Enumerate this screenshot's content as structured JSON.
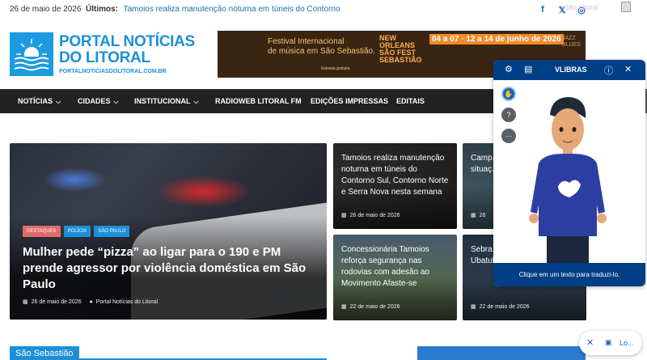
{
  "topbar": {
    "date": "26 de maio de 2026",
    "latest_label": "Últimos:",
    "latest_headline": "Tamoios realiza manutenção noturna em túneis do Contorno",
    "faded_text": "dão Litoral"
  },
  "header": {
    "logo_line1": "PORTAL NOTÍCIAS",
    "logo_line2": "DO LITORAL",
    "logo_url": "PORTALNOTICIASDOLITORAL.COM.BR",
    "banner": {
      "line1": "Festival Internacional",
      "line2": "de música em São Sebastião.",
      "small": "Entrada gratuita",
      "brand": "NEW ORLEANS SÃO FEST SEBASTIÃO",
      "dates": "04 a 07 · 12 a 14 de junho de 2026",
      "side": "JAZZ BLUES"
    }
  },
  "nav": {
    "items": [
      {
        "label": "NOTÍCIAS",
        "dropdown": true
      },
      {
        "label": "CIDADES",
        "dropdown": true
      },
      {
        "label": "INSTITUCIONAL",
        "dropdown": true
      },
      {
        "label": "RADIOWEB LITORAL FM",
        "dropdown": false
      },
      {
        "label": "EDIÇÕES IMPRESSAS",
        "dropdown": false
      },
      {
        "label": "EDITAIS",
        "dropdown": false
      }
    ]
  },
  "main_story": {
    "tags": [
      {
        "label": "DESTAQUES",
        "color": "#e06a6a"
      },
      {
        "label": "POLÍCIA",
        "color": "#1c8fd8"
      },
      {
        "label": "SÃO PAULO",
        "color": "#1c8fd8"
      }
    ],
    "title": "Mulher pede “pizza” ao ligar para o 190 e PM prende agressor por violência doméstica em São Paulo",
    "date": "26 de maio de 2026",
    "author": "Portal Notícias do Litoral"
  },
  "side_stories": [
    {
      "title": "Tamoios realiza manutenção noturna em túneis do Contorno Sul, Contorno Norte e Serra Nova nesta semana",
      "date": "26 de maio de 2026"
    },
    {
      "title": "Camp... 2026 d... para a... situaç...",
      "date": "26"
    },
    {
      "title": "Concessionária Tamoios reforça segurança nas rodovias com adesão ao Movimento Afaste-se",
      "date": "22 de maio de 2026"
    },
    {
      "title": "Sebra... progr... do ME... Ubatuba",
      "date": "22 de maio de 2026"
    }
  ],
  "section": {
    "label": "São Sebastião"
  },
  "vlibras": {
    "title": "VLIBRAS",
    "footer": "Clique em um texto para traduzi-lo.",
    "side_icons": [
      "hand-icon",
      "help-icon",
      "more-icon"
    ]
  },
  "pill": {
    "label": "Lo..."
  },
  "colors": {
    "brand": "#1c8fd8",
    "nav_bg": "#222222",
    "vlibras": "#003f86"
  }
}
